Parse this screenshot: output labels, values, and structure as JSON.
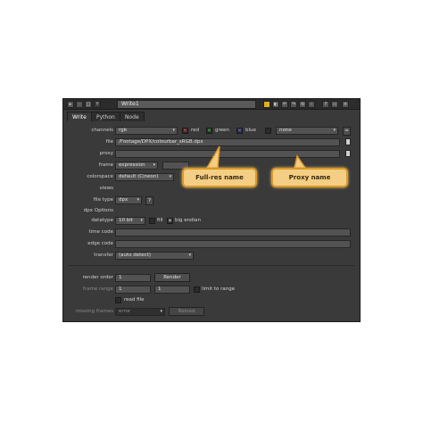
{
  "window": {
    "title": "Write1",
    "tabs": [
      "Write",
      "Python",
      "Node"
    ]
  },
  "form": {
    "channels": {
      "label": "channels",
      "value": "rgb",
      "red": "red",
      "green": "green",
      "blue": "blue",
      "alpha": "none"
    },
    "file": {
      "label": "file",
      "value": "/Footage/DPX/colourbar_sRGB.dpx"
    },
    "proxy": {
      "label": "proxy",
      "value": ""
    },
    "frame": {
      "label": "frame",
      "value": "expression"
    },
    "colorspace": {
      "label": "colorspace",
      "value": "default (Cineon)"
    },
    "views": {
      "label": "views"
    },
    "file_type": {
      "label": "file type",
      "value": "dpx",
      "help": "?"
    },
    "dpx_options": "dpx Options",
    "datatype": {
      "label": "datatype",
      "value": "10 bit",
      "fill": "fill",
      "big_endian": "big endian"
    },
    "time_code": {
      "label": "time code",
      "value": ""
    },
    "edge_code": {
      "label": "edge code",
      "value": ""
    },
    "transfer": {
      "label": "transfer",
      "value": "(auto detect)"
    },
    "render_order": {
      "label": "render order",
      "value": "1",
      "button": "Render"
    },
    "frame_range": {
      "label": "frame range",
      "from": "1",
      "to": "1",
      "limit": "limit to range"
    },
    "read_file": "read file",
    "missing_frames": {
      "label": "missing frames",
      "value": "error",
      "button": "Reload"
    }
  },
  "callouts": {
    "full_res": "Full-res name",
    "proxy": "Proxy name"
  },
  "colors": {
    "panel_bg": "#3a3a3a",
    "callout_fill": "#f4ce84",
    "callout_border": "#d99a2a"
  }
}
